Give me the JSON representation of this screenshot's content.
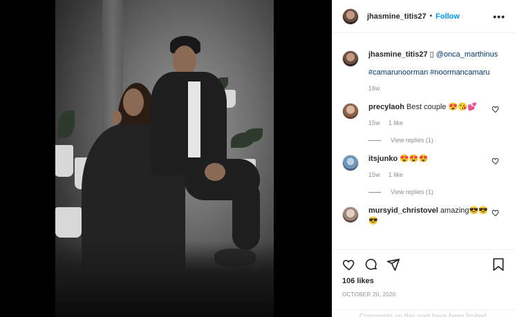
{
  "post": {
    "username": "jhasmine_titis27",
    "dot": "•",
    "follow_label": "Follow",
    "more_label": "•••",
    "photo_alt": "photo"
  },
  "caption": {
    "username": "jhasmine_titis27",
    "symbol": "▯",
    "mention": "@onca_marthinus",
    "hashtags": "#camarunoorman #noormancamaru",
    "age": "16w"
  },
  "comments": [
    {
      "username": "precylaoh",
      "text": "Best couple 😍😘💕",
      "age": "15w",
      "likes": "1 like",
      "replies": "View replies (1)"
    },
    {
      "username": "itsjunko",
      "text": "😍😍😍",
      "age": "15w",
      "likes": "1 like",
      "replies": "View replies (1)"
    },
    {
      "username": "mursyid_christovel",
      "text": "amazing😎😎😎"
    }
  ],
  "actions": {
    "likes": "106 likes",
    "date": "OCTOBER 20, 2020",
    "comment_notice": "Comments on this post have been limited."
  },
  "colors": {
    "accent": "#0095f6",
    "muted": "#8e8e8e",
    "link": "#00376b",
    "border": "#efefef"
  }
}
